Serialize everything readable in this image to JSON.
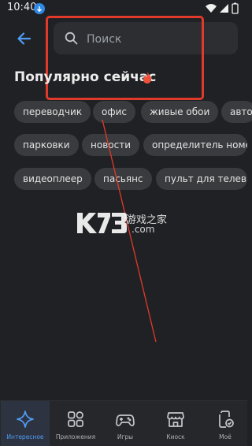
{
  "status_bar": {
    "time": "10:40"
  },
  "search": {
    "placeholder": "Поиск"
  },
  "section": {
    "title": "Популярно сейчас"
  },
  "chips": [
    "переводчик",
    "офис",
    "живые обои",
    "авто",
    "парковки",
    "новости",
    "определитель номера",
    "видеоплеер",
    "пасьянс",
    "пульт для телевизора"
  ],
  "watermark": {
    "logo": "K73",
    "site_text": "游戏之家",
    "domain": ".com"
  },
  "nav": [
    {
      "label": "Интересное",
      "icon": "sparkle-icon",
      "active": true
    },
    {
      "label": "Приложения",
      "icon": "apps-grid-icon",
      "active": false
    },
    {
      "label": "Игры",
      "icon": "gamepad-icon",
      "active": false
    },
    {
      "label": "Киоск",
      "icon": "store-icon",
      "active": false
    },
    {
      "label": "Моё",
      "icon": "my-apps-icon",
      "active": false
    }
  ],
  "colors": {
    "accent": "#4f9df5",
    "annotation": "#e23a2a",
    "background": "#202124"
  }
}
